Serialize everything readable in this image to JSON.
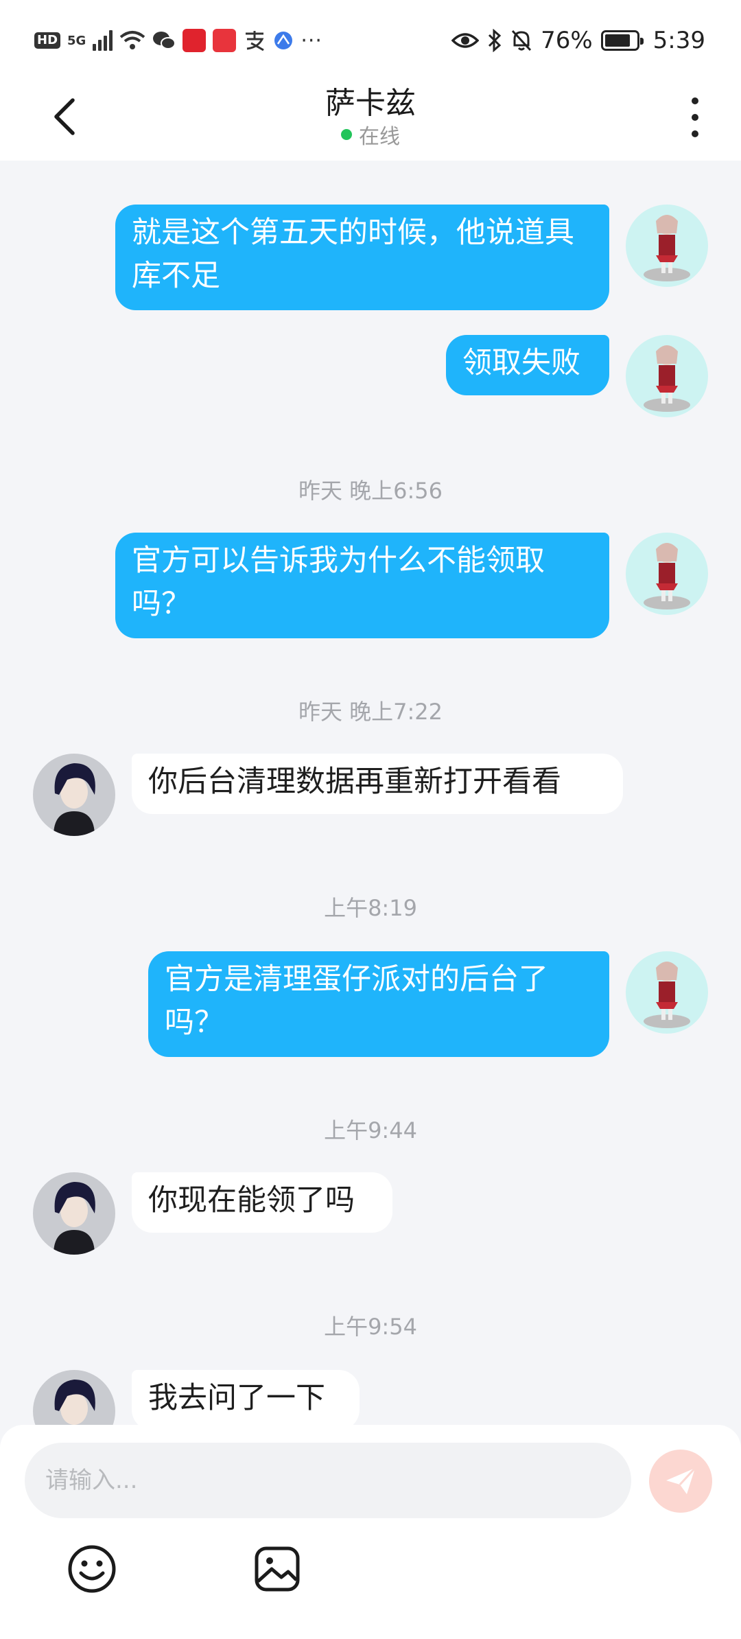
{
  "status_bar": {
    "network": "5G",
    "battery": "76%",
    "time": "5:39"
  },
  "header": {
    "title": "萨卡兹",
    "presence": "在线"
  },
  "messages": [
    {
      "side": "out",
      "text": "就是这个第五天的时候，他说道具库不足"
    },
    {
      "side": "out",
      "text": "领取失败"
    },
    {
      "type": "timestamp",
      "text": "昨天 晚上6:56"
    },
    {
      "side": "out",
      "text": "官方可以告诉我为什么不能领取吗？"
    },
    {
      "type": "timestamp",
      "text": "昨天 晚上7:22"
    },
    {
      "side": "in",
      "text": "你后台清理数据再重新打开看看"
    },
    {
      "type": "timestamp",
      "text": "上午8:19"
    },
    {
      "side": "out",
      "text": "官方是清理蛋仔派对的后台了吗？"
    },
    {
      "type": "timestamp",
      "text": "上午9:44"
    },
    {
      "side": "in",
      "text": "你现在能领了吗"
    },
    {
      "type": "timestamp",
      "text": "上午9:54"
    },
    {
      "side": "in",
      "text": "我去问了一下"
    }
  ],
  "composer": {
    "placeholder": "请输入..."
  },
  "icons": [
    "back-icon",
    "more-icon",
    "send-icon",
    "emoji-icon",
    "image-icon"
  ],
  "colors": {
    "outgoing_bubble": "#1fb4fb",
    "incoming_bubble": "#ffffff",
    "online_dot": "#22c45a",
    "send_button": "#fcd7d1"
  }
}
